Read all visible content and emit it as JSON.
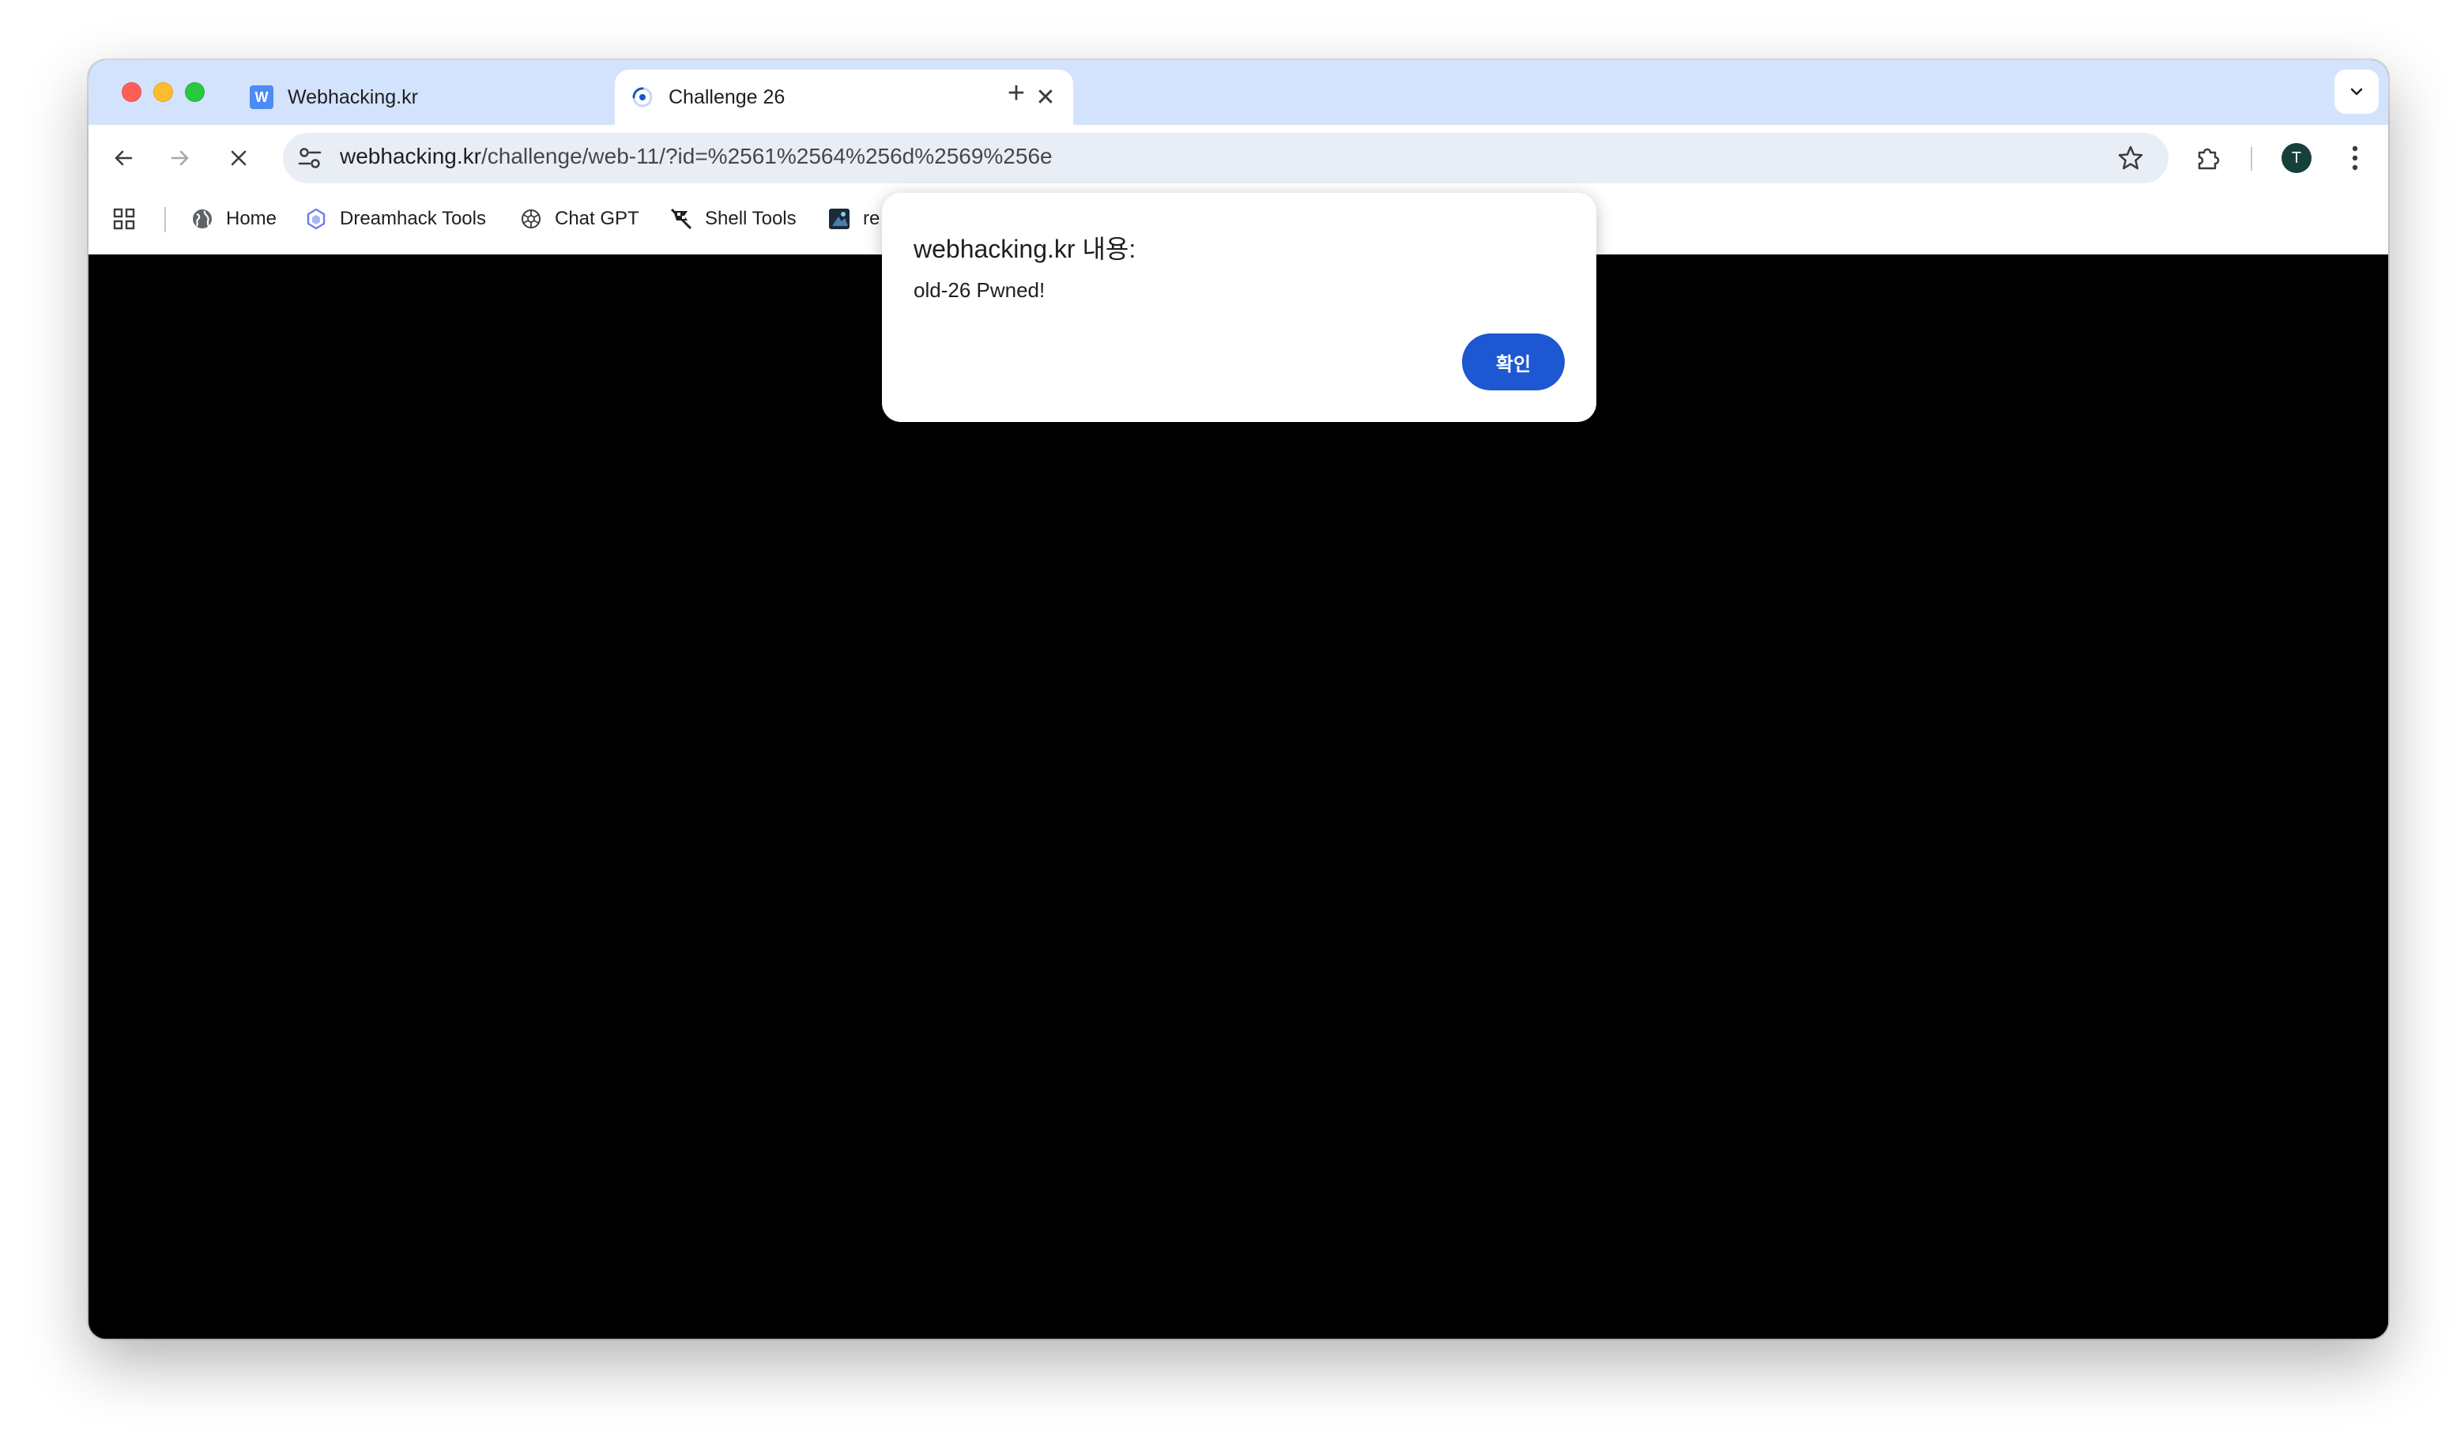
{
  "tabs": [
    {
      "title": "Webhacking.kr",
      "favicon": "W",
      "active": false
    },
    {
      "title": "Challenge 26",
      "active": true
    }
  ],
  "tab_close_glyph": "✕",
  "new_tab_glyph": "+",
  "address": {
    "host": "webhacking.kr",
    "path": "/challenge/web-11/?id=%2561%2564%256d%2569%256e"
  },
  "profile_initial": "T",
  "bookmarks": [
    {
      "label": "Home",
      "icon": "globe-icon"
    },
    {
      "label": "Dreamhack Tools",
      "icon": "hexagon-icon"
    },
    {
      "label": "Chat GPT",
      "icon": "openai-icon"
    },
    {
      "label": "Shell Tools",
      "icon": "flag-icon"
    },
    {
      "label": "re",
      "icon": "app-icon"
    }
  ],
  "dialog": {
    "title": "webhacking.kr 내용:",
    "message": "old-26 Pwned!",
    "ok_label": "확인"
  },
  "colors": {
    "tabstrip": "#d3e3fd",
    "omnibox": "#e9eef6",
    "dialog_button": "#1d57d1",
    "content_bg": "#000000"
  }
}
